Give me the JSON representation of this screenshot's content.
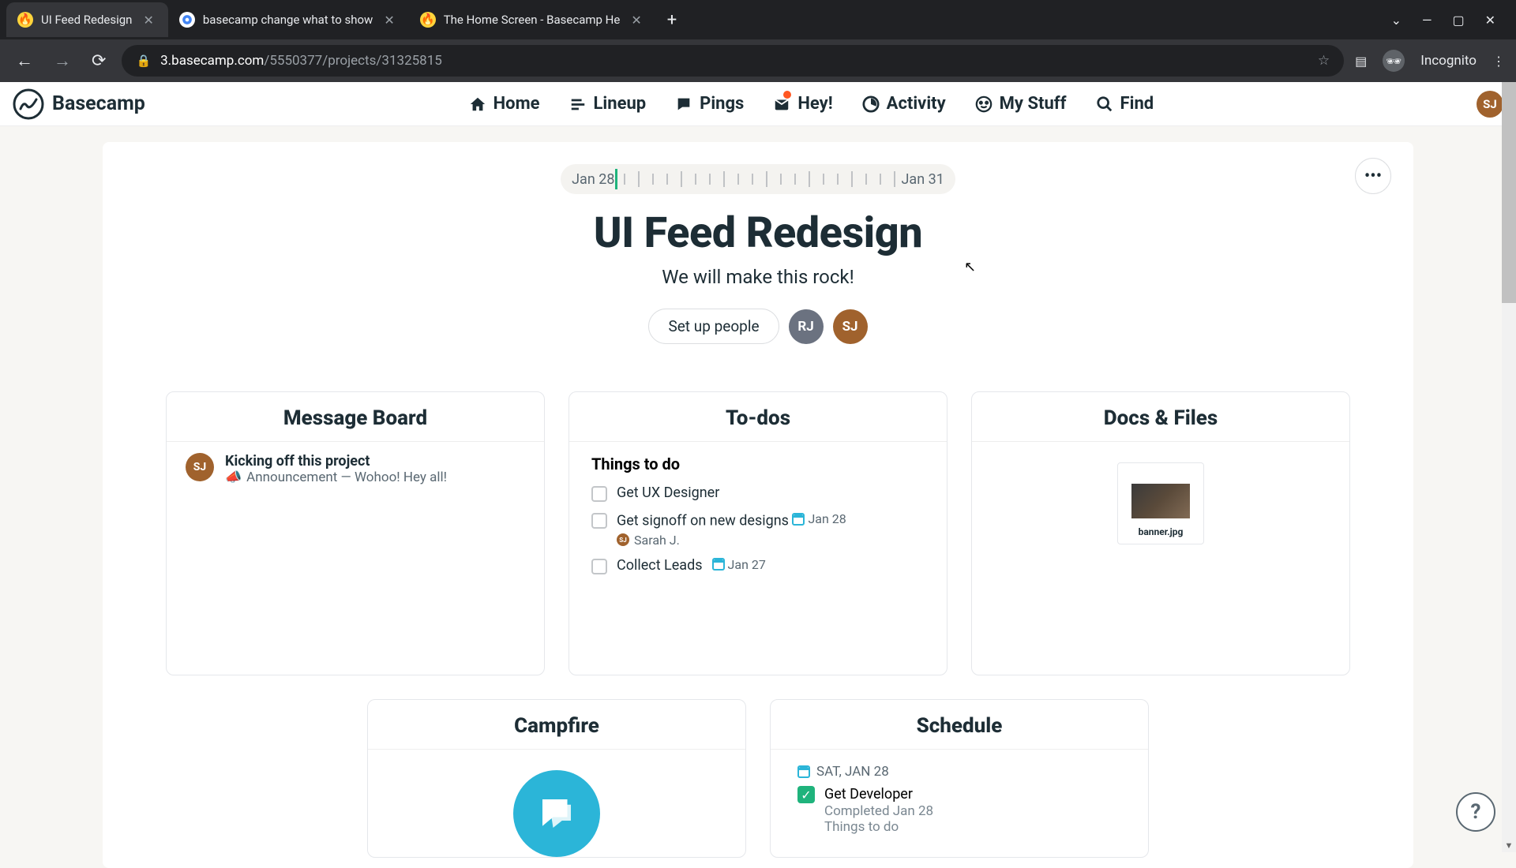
{
  "browser": {
    "tabs": [
      {
        "title": "UI Feed Redesign",
        "active": true
      },
      {
        "title": "basecamp change what to show",
        "active": false
      },
      {
        "title": "The Home Screen - Basecamp He",
        "active": false
      }
    ],
    "url_host": "3.basecamp.com",
    "url_path": "/5550377/projects/31325815",
    "incognito_label": "Incognito"
  },
  "nav": {
    "logo": "Basecamp",
    "items": {
      "home": "Home",
      "lineup": "Lineup",
      "pings": "Pings",
      "hey": "Hey!",
      "activity": "Activity",
      "mystuff": "My Stuff",
      "find": "Find"
    },
    "avatar": "SJ"
  },
  "project": {
    "date_start": "Jan 28",
    "date_end": "Jan 31",
    "title": "UI Feed Redesign",
    "subtitle": "We will make this rock!",
    "setup_people": "Set up people",
    "people": [
      {
        "initials": "RJ",
        "cls": "rj"
      },
      {
        "initials": "SJ",
        "cls": "sj"
      }
    ]
  },
  "cards": {
    "message_board": {
      "title": "Message Board",
      "items": [
        {
          "avatar": "SJ",
          "title": "Kicking off this project",
          "sub": "Announcement — Wohoo! Hey all!"
        }
      ]
    },
    "todos": {
      "title": "To-dos",
      "list_name": "Things to do",
      "items": [
        {
          "text": "Get UX Designer"
        },
        {
          "text": "Get signoff on new designs",
          "date": "Jan 28",
          "assignee": "Sarah J.",
          "assignee_av": "SJ"
        },
        {
          "text": "Collect Leads",
          "date": "Jan 27"
        }
      ]
    },
    "docs": {
      "title": "Docs & Files",
      "files": [
        {
          "name": "banner.jpg"
        }
      ]
    },
    "campfire": {
      "title": "Campfire"
    },
    "schedule": {
      "title": "Schedule",
      "date": "SAT, JAN 28",
      "item": "Get Developer",
      "completed": "Completed Jan 28",
      "sub": "Things to do"
    }
  },
  "help": "?"
}
